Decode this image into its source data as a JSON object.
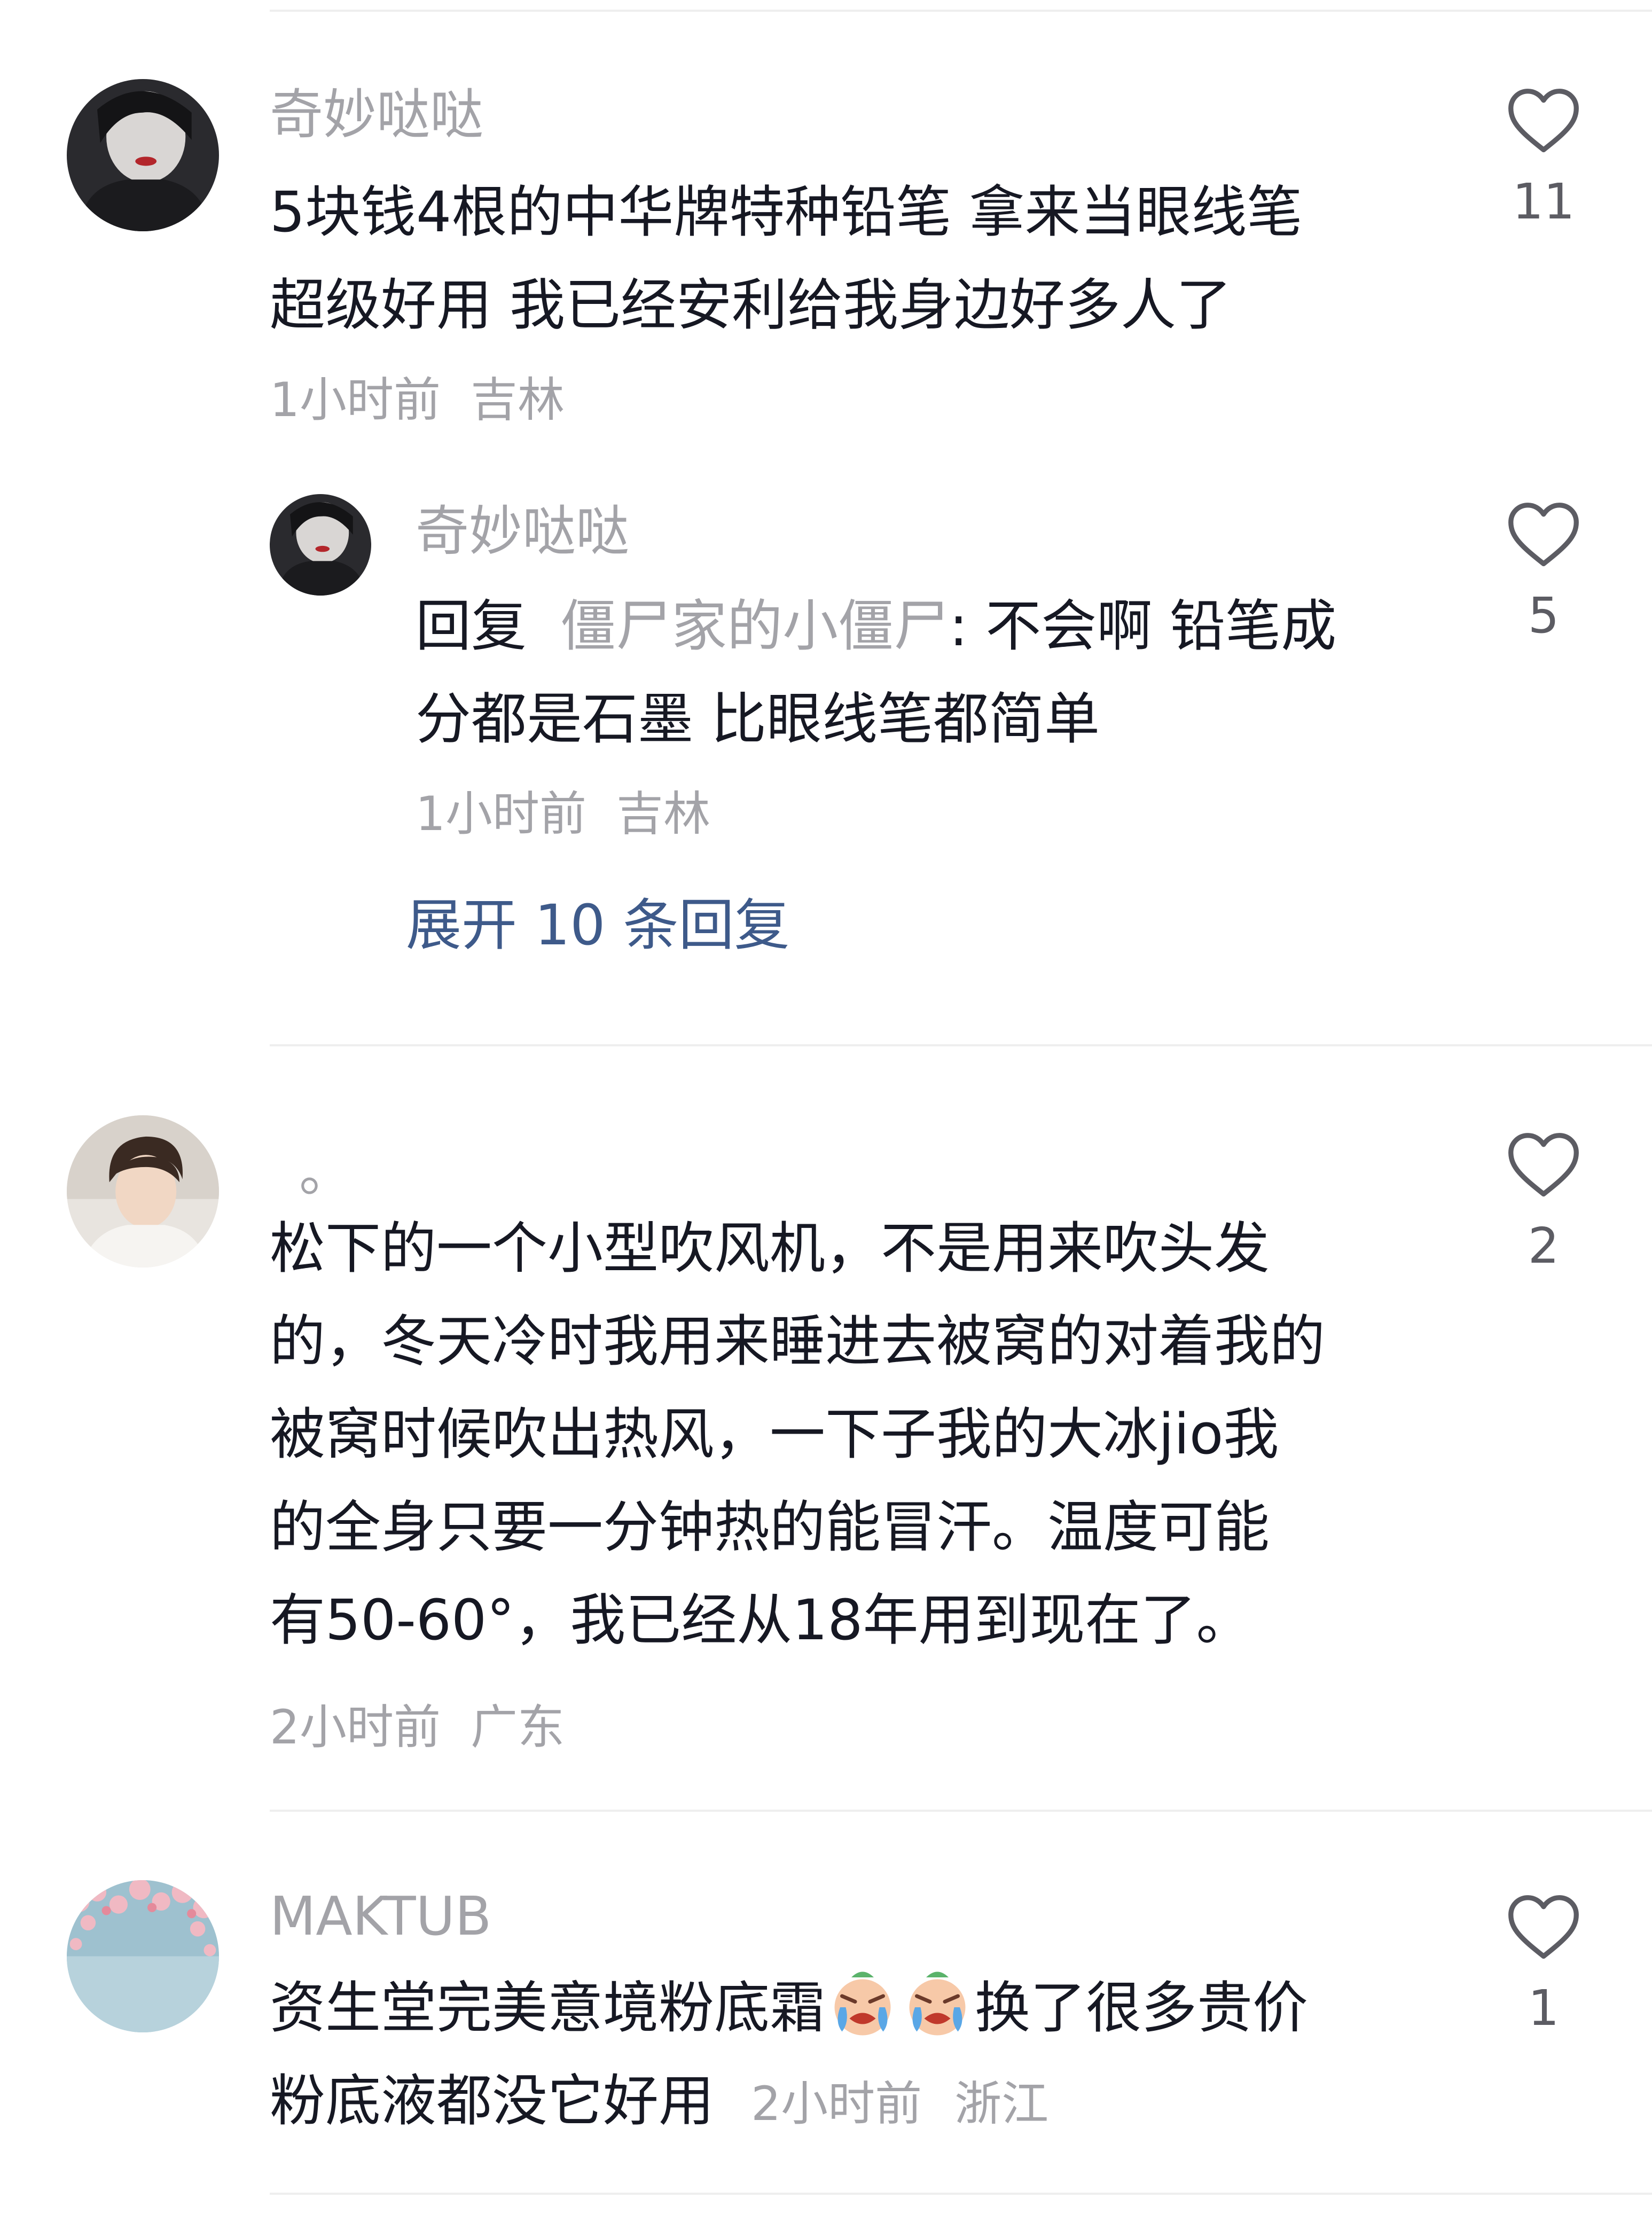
{
  "comments": [
    {
      "username": "奇妙哒哒",
      "lines": [
        "5块钱4根的中华牌特种铅笔 拿来当眼线笔",
        "超级好用 我已经安利给我身边好多人了"
      ],
      "time": "1小时前",
      "location": "吉林",
      "likes": "11",
      "avatar_icon": "avatar-dark-portrait",
      "reply": {
        "username": "奇妙哒哒",
        "prefix": "回复",
        "reply_to": "僵尸家的小僵尸",
        "line1_text": ": 不会啊 铅笔成",
        "line2_text": "分都是石墨 比眼线笔都简单",
        "time": "1小时前",
        "location": "吉林",
        "likes": "5",
        "avatar_icon": "avatar-dark-portrait"
      },
      "expand_label": "展开 10 条回复"
    },
    {
      "username": "。",
      "lines": [
        "松下的一个小型吹风机，不是用来吹头发",
        "的，冬天冷时我用来睡进去被窝的对着我的",
        "被窝时候吹出热风，一下子我的大冰jio我",
        "的全身只要一分钟热的能冒汗。温度可能",
        "有50-60°，我已经从18年用到现在了。"
      ],
      "time": "2小时前",
      "location": "广东",
      "likes": "2",
      "avatar_icon": "avatar-young-man"
    },
    {
      "username": "MAKTUB",
      "line1_text_before_emoji": "资生堂完美意境粉底霜",
      "line1_text_after_emoji": "换了很多贵价",
      "line2_text": "粉底液都没它好用",
      "emoji_icon": "crying-face-emoji",
      "time": "2小时前",
      "location": "浙江",
      "likes": "1",
      "avatar_icon": "avatar-cherry-blossom"
    }
  ],
  "colors": {
    "text": "#161823",
    "muted": "#a3a3a8",
    "link": "#3e5a8a",
    "divider": "#eeeeee"
  }
}
